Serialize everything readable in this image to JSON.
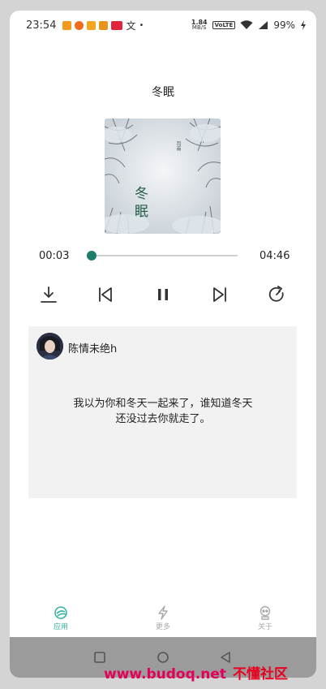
{
  "status_bar": {
    "time": "23:54",
    "app_icons": [
      {
        "name": "app1-icon",
        "color": "#f29a1d"
      },
      {
        "name": "app2-icon",
        "color": "#f26b1d"
      },
      {
        "name": "app3-icon",
        "color": "#f2a51d"
      },
      {
        "name": "app4-icon",
        "color": "#e8931a"
      },
      {
        "name": "app5-icon",
        "color": "#e0243a"
      }
    ],
    "net_speed_value": "1.84",
    "net_speed_unit": "MB/S",
    "volte": "VoLTE",
    "battery": "99%"
  },
  "player": {
    "title": "冬眠",
    "cover_title": "冬眠",
    "cover_artist": "司南",
    "current_time": "00:03",
    "total_time": "04:46",
    "progress": 0.01,
    "accent_color": "#1d7f6a"
  },
  "controls": [
    "download-icon",
    "previous-icon",
    "pause-icon",
    "next-icon",
    "repeat-icon"
  ],
  "comment": {
    "username": "陈情未绝h",
    "text": "我以为你和冬天一起来了，谁知道冬天还没过去你就走了。"
  },
  "tabs": [
    {
      "label": "应用",
      "icon": "app-tab-icon",
      "active": true
    },
    {
      "label": "更多",
      "icon": "lightning-icon",
      "active": false
    },
    {
      "label": "关于",
      "icon": "robot-icon",
      "active": false
    }
  ],
  "watermark": {
    "url": "www.budoq.net",
    "text": "不懂社区"
  }
}
